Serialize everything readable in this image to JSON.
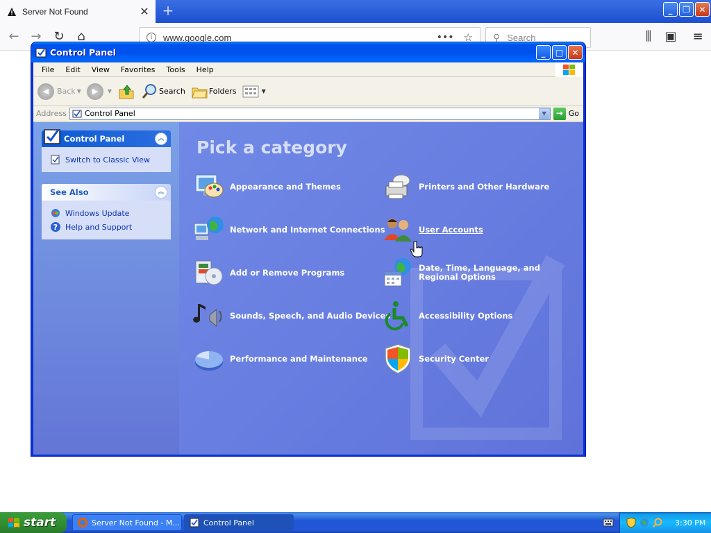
{
  "firefox": {
    "tab_title": "Server Not Found",
    "url": "www.google.com",
    "search_placeholder": "Search"
  },
  "window": {
    "title": "Control Panel",
    "menu": [
      "File",
      "Edit",
      "View",
      "Favorites",
      "Tools",
      "Help"
    ],
    "toolbar": {
      "back": "Back",
      "search": "Search",
      "folders": "Folders"
    },
    "address": {
      "label": "Address",
      "value": "Control Panel",
      "go": "Go"
    }
  },
  "sidebar": {
    "control_panel": {
      "title": "Control Panel",
      "links": [
        "Switch to Classic View"
      ]
    },
    "see_also": {
      "title": "See Also",
      "links": [
        "Windows Update",
        "Help and Support"
      ]
    }
  },
  "main": {
    "heading": "Pick a category",
    "categories": [
      {
        "label": "Appearance and Themes",
        "icon": "appearance-icon"
      },
      {
        "label": "Printers and Other Hardware",
        "icon": "printer-icon"
      },
      {
        "label": "Network and Internet Connections",
        "icon": "network-icon"
      },
      {
        "label": "User Accounts",
        "icon": "user-accounts-icon"
      },
      {
        "label": "Add or Remove Programs",
        "icon": "add-remove-programs-icon"
      },
      {
        "label": "Date, Time, Language, and Regional Options",
        "icon": "date-time-icon"
      },
      {
        "label": "Sounds, Speech, and Audio Devices",
        "icon": "sounds-icon"
      },
      {
        "label": "Accessibility Options",
        "icon": "accessibility-icon"
      },
      {
        "label": "Performance and Maintenance",
        "icon": "performance-icon"
      },
      {
        "label": "Security Center",
        "icon": "security-shield-icon"
      }
    ]
  },
  "taskbar": {
    "start": "start",
    "tasks": [
      "Server Not Found - M...",
      "Control Panel"
    ],
    "clock": "3:30 PM"
  },
  "colors": {
    "xp_blue": "#0831d9",
    "panel_bg": "#6b7ee0",
    "start_green": "#319131"
  }
}
